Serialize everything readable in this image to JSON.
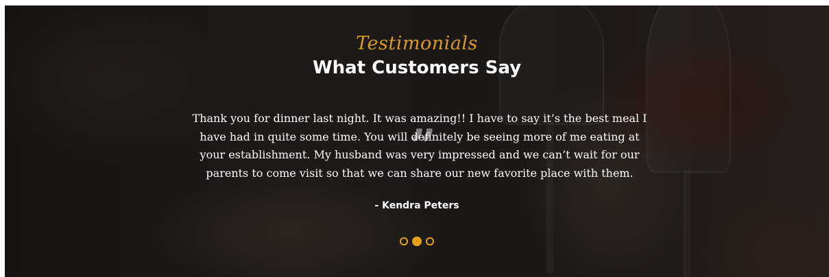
{
  "testimonials": {
    "eyebrow": "Testimonials",
    "heading": "What Customers Say",
    "quote": "Thank you for dinner last night. It was amazing!! I have to say it’s the best meal I have had in quite some time. You will definitely be seeing more of me eating at your establishment. My husband was very impressed and we can’t wait for our parents to come visit so that we can share our new favorite place with them.",
    "author": "- Kendra Peters",
    "quote_icon": "quote-icon",
    "slider": {
      "slide_count": 3,
      "active_index": 1
    }
  },
  "colors": {
    "accent": "#e3a21a",
    "text": "#ffffff"
  }
}
